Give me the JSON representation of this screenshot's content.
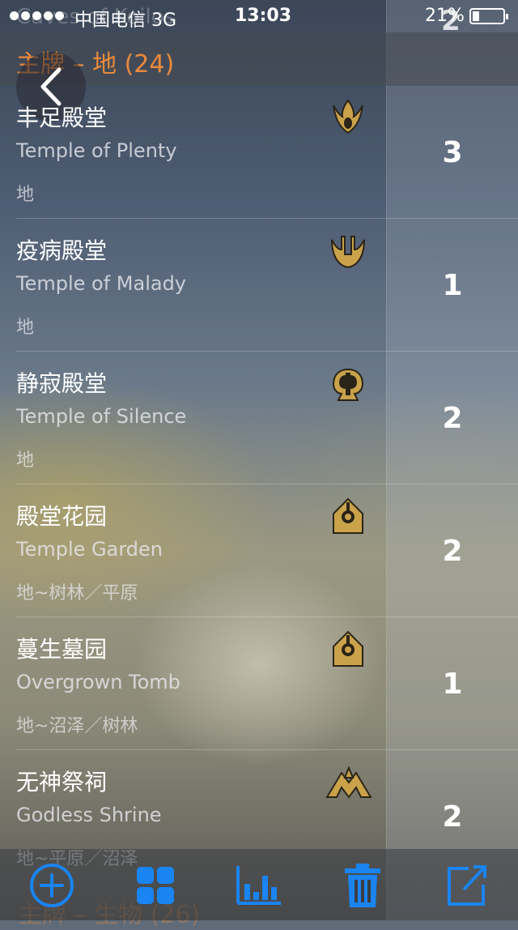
{
  "status_bar": {
    "carrier": "中国电信  3G",
    "time": "13:03",
    "battery_percent": "21%",
    "battery_level": 0.21
  },
  "previous_row": {
    "name": "Caves of Koilos",
    "count": "2"
  },
  "section": {
    "title": "主牌 – 地 (24)"
  },
  "cards": [
    {
      "name_cn": "丰足殿堂",
      "name_en": "Temple of Plenty",
      "type": "地",
      "set_icon": "theros-set-icon",
      "count": "3"
    },
    {
      "name_cn": "疫病殿堂",
      "name_en": "Temple of Malady",
      "type": "地",
      "set_icon": "m15-set-icon",
      "count": "1"
    },
    {
      "name_cn": "静寂殿堂",
      "name_en": "Temple of Silence",
      "type": "地",
      "set_icon": "m15-set-icon",
      "count": "2"
    },
    {
      "name_cn": "殿堂花园",
      "name_en": "Temple Garden",
      "type": "地~树林／平原",
      "set_icon": "rtr-guild-set-icon",
      "count": "2"
    },
    {
      "name_cn": "蔓生墓园",
      "name_en": "Overgrown Tomb",
      "type": "地~沼泽／树林",
      "set_icon": "rtr-guild-set-icon",
      "count": "1"
    },
    {
      "name_cn": "无神祭祠",
      "name_en": "Godless Shrine",
      "type": "地~平原／沼泽",
      "set_icon": "gatecrash-set-icon",
      "count": "2"
    }
  ],
  "next_section": {
    "title": "主牌 – 生物 (26)"
  },
  "toolbar": {
    "buttons": [
      "add-icon",
      "grid-icon",
      "bar-chart-icon",
      "trash-icon",
      "share-icon"
    ],
    "accent": "#1a84f2"
  },
  "colors": {
    "section_title": "#e98a3c",
    "icon_gold": "#c9a24a"
  }
}
